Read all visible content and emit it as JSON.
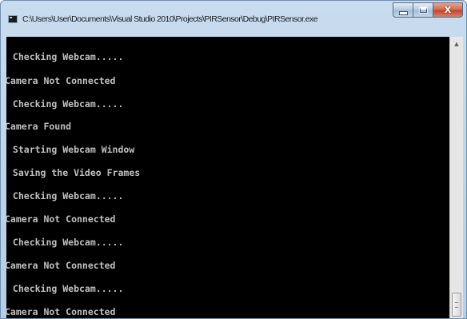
{
  "window": {
    "title": "C:\\Users\\User\\Documents\\Visual Studio 2010\\Projects\\PIRSensor\\Debug\\PIRSensor.exe",
    "app_icon": "console-app-icon",
    "buttons": {
      "minimize_icon": "minimize-icon",
      "maximize_icon": "maximize-icon",
      "close_label": "X",
      "close_icon": "close-icon"
    }
  },
  "console": {
    "background": "#000000",
    "text_color": "#c0c0c0",
    "lines": [
      " Checking Webcam.....",
      "Camera Not Connected",
      " Checking Webcam.....",
      "Camera Found",
      " Starting Webcam Window",
      " Saving the Video Frames",
      " Checking Webcam.....",
      "Camera Not Connected",
      " Checking Webcam.....",
      "Camera Not Connected",
      " Checking Webcam.....",
      "Camera Not Connected"
    ]
  },
  "scrollbar": {
    "up_arrow_icon": "scroll-up-arrow-icon",
    "up_arrow_glyph": "▲",
    "thumb_icon": "scroll-thumb-grip-icon"
  }
}
